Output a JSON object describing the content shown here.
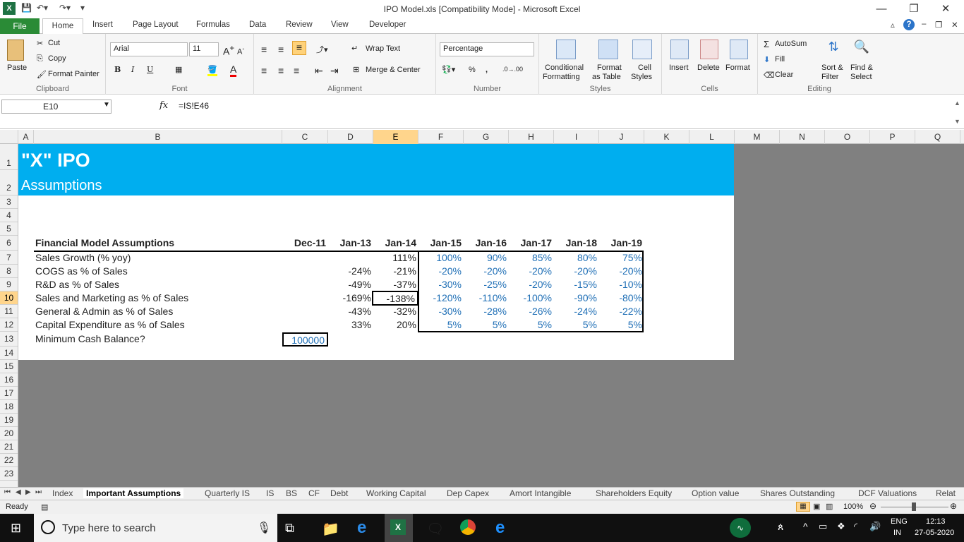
{
  "window": {
    "title": "IPO Model.xls  [Compatibility Mode]  -  Microsoft Excel"
  },
  "tabs": [
    "File",
    "Home",
    "Insert",
    "Page Layout",
    "Formulas",
    "Data",
    "Review",
    "View",
    "Developer"
  ],
  "ribbon": {
    "clipboard": {
      "paste": "Paste",
      "cut": "Cut",
      "copy": "Copy",
      "format_painter": "Format Painter",
      "label": "Clipboard"
    },
    "font": {
      "name": "Arial",
      "size": "11",
      "label": "Font"
    },
    "alignment": {
      "wrap": "Wrap Text",
      "merge": "Merge & Center",
      "label": "Alignment"
    },
    "number": {
      "format": "Percentage",
      "label": "Number"
    },
    "styles": {
      "conditional1": "Conditional",
      "conditional2": "Formatting",
      "table1": "Format",
      "table2": "as Table",
      "cell1": "Cell",
      "cell2": "Styles",
      "label": "Styles"
    },
    "cells": {
      "insert": "Insert",
      "delete": "Delete",
      "format": "Format",
      "label": "Cells"
    },
    "editing": {
      "autosum": "AutoSum",
      "fill": "Fill",
      "clear": "Clear",
      "sort1": "Sort &",
      "sort2": "Filter",
      "find1": "Find &",
      "find2": "Select",
      "label": "Editing"
    }
  },
  "formula_bar": {
    "name_box": "E10",
    "formula": "=IS!E46"
  },
  "columns": [
    "A",
    "B",
    "C",
    "D",
    "E",
    "F",
    "G",
    "H",
    "I",
    "J",
    "K",
    "L",
    "M",
    "N",
    "O",
    "P",
    "Q"
  ],
  "rows": [
    "1",
    "2",
    "3",
    "4",
    "5",
    "6",
    "7",
    "8",
    "9",
    "10",
    "11",
    "12",
    "13",
    "14",
    "15",
    "16",
    "17",
    "18",
    "19",
    "20",
    "21",
    "22",
    "23"
  ],
  "sheet": {
    "title": "\"X\" IPO",
    "subtitle": "Assumptions",
    "header": {
      "label": "Financial Model Assumptions",
      "periods": [
        "Dec-11",
        "Jan-13",
        "Jan-14",
        "Jan-15",
        "Jan-16",
        "Jan-17",
        "Jan-18",
        "Jan-19"
      ]
    },
    "rows": [
      {
        "label": "Sales Growth (% yoy)",
        "d": "",
        "e": "111%",
        "proj": [
          "100%",
          "90%",
          "85%",
          "80%",
          "75%"
        ]
      },
      {
        "label": "COGS as % of Sales",
        "d": "-24%",
        "e": "-21%",
        "proj": [
          "-20%",
          "-20%",
          "-20%",
          "-20%",
          "-20%"
        ]
      },
      {
        "label": "R&D as % of Sales",
        "d": "-49%",
        "e": "-37%",
        "proj": [
          "-30%",
          "-25%",
          "-20%",
          "-15%",
          "-10%"
        ]
      },
      {
        "label": "Sales and Marketing as % of Sales",
        "d": "-169%",
        "e": "-138%",
        "proj": [
          "-120%",
          "-110%",
          "-100%",
          "-90%",
          "-80%"
        ]
      },
      {
        "label": "General & Admin as % of Sales",
        "d": "-43%",
        "e": "-32%",
        "proj": [
          "-30%",
          "-28%",
          "-26%",
          "-24%",
          "-22%"
        ]
      },
      {
        "label": "Capital Expenditure as % of Sales",
        "d": "33%",
        "e": "20%",
        "proj": [
          "5%",
          "5%",
          "5%",
          "5%",
          "5%"
        ]
      }
    ],
    "min_cash": {
      "label": "Minimum Cash Balance?",
      "value": "100000"
    }
  },
  "sheet_tabs": [
    "Index",
    "Important Assumptions",
    "Quarterly IS",
    "IS",
    "BS",
    "CF",
    "Debt",
    "Working Capital",
    "Dep Capex",
    "Amort Intangible",
    "Shareholders Equity",
    "Option value",
    "Shares Outstanding",
    "DCF Valuations",
    "Relat"
  ],
  "status": {
    "ready": "Ready",
    "zoom": "100%"
  },
  "taskbar": {
    "search": "Type here to search",
    "lang1": "ENG",
    "lang2": "IN",
    "time": "12:13",
    "date": "27-05-2020"
  }
}
